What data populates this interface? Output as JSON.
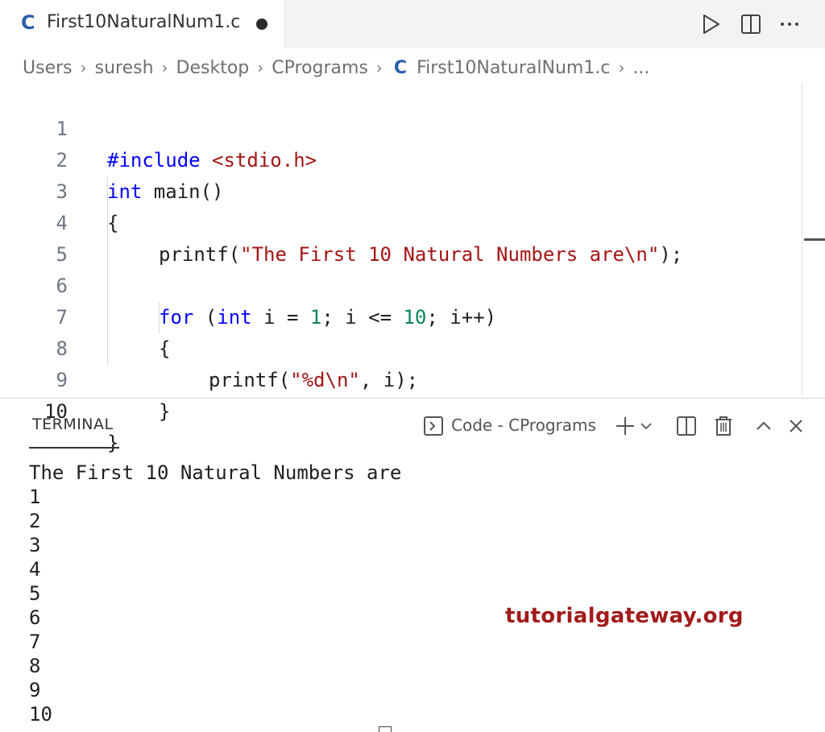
{
  "tab": {
    "icon_letter": "C",
    "title": "First10NaturalNum1.c"
  },
  "breadcrumb": {
    "items": [
      "Users",
      "suresh",
      "Desktop",
      "CPrograms"
    ],
    "file_icon": "C",
    "file": "First10NaturalNum1.c",
    "more": "..."
  },
  "editor": {
    "line_numbers": [
      "1",
      "2",
      "3",
      "4",
      "5",
      "6",
      "7",
      "8",
      "9",
      "10"
    ],
    "lines": [
      "#include <stdio.h>",
      "int main()",
      "{",
      "    printf(\"The First 10 Natural Numbers are\\n\");",
      "",
      "    for (int i = 1; i <= 10; i++)",
      "    {",
      "        printf(\"%d\\n\", i);",
      "    }",
      "}"
    ],
    "tokens": {
      "include": "#include",
      "header": "<stdio.h>",
      "int": "int",
      "main": " main()",
      "brace_open": "{",
      "brace_close": "}",
      "printf": "printf(",
      "str1": "\"The First 10 Natural Numbers are\\n\"",
      "end1": ");",
      "for": "for",
      "for_open": " (",
      "int2": "int",
      "for_mid1": " i = ",
      "one": "1",
      "for_mid2": "; i <= ",
      "ten": "10",
      "for_end": "; i++)",
      "str2": "\"%d\\n\"",
      "end2": ", i);"
    }
  },
  "panel": {
    "title": "TERMINAL",
    "terminal_name": "Code - CPrograms"
  },
  "terminal": {
    "output": "The First 10 Natural Numbers are\n1\n2\n3\n4\n5\n6\n7\n8\n9\n10"
  },
  "watermark": "tutorialgateway.org",
  "colors": {
    "keyword": "#0000ff",
    "string": "#a31515",
    "number": "#098658",
    "c_icon": "#2b5ea8",
    "watermark": "#a11b1b"
  }
}
